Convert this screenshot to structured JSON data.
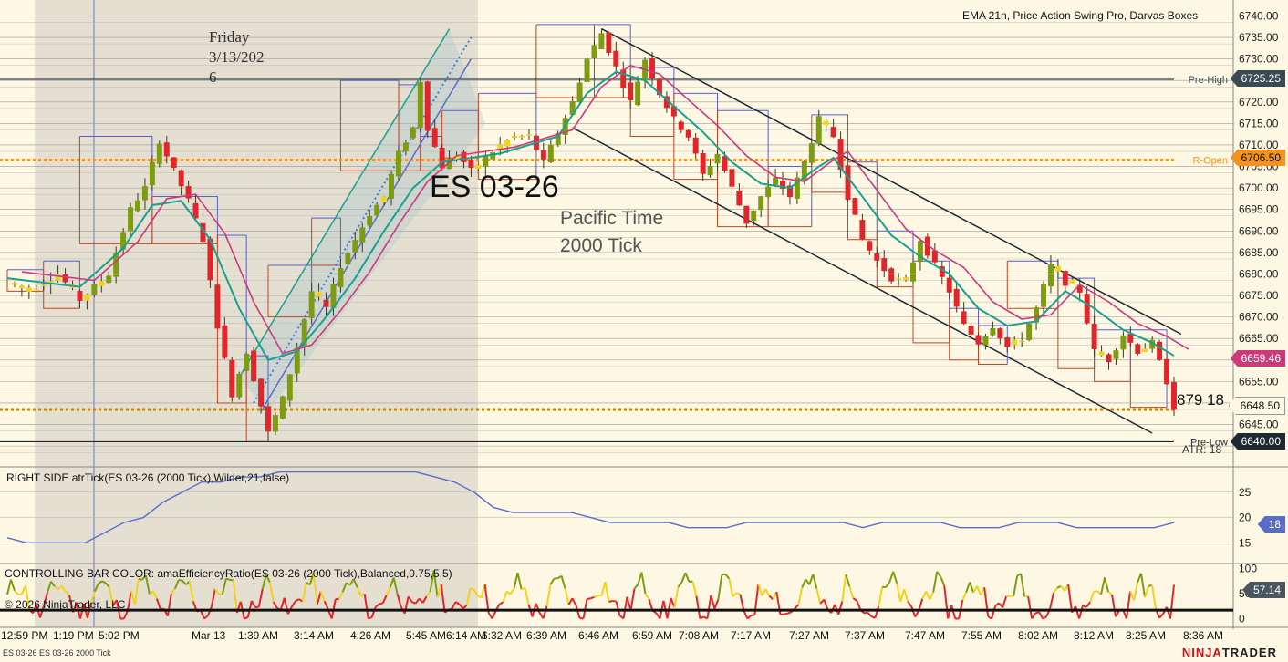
{
  "chart_data": {
    "type": "candlestick",
    "instrument": "ES 03-26",
    "subtitle_lines": [
      "Pacific Time",
      "2000 Tick"
    ],
    "session_label_lines": [
      "Friday",
      "3/13/202",
      "6"
    ],
    "indicators_title": "EMA 21n, Price Action Swing Pro, Darvas Boxes",
    "y_range": [
      6636,
      6742
    ],
    "y_ticks": [
      6640,
      6645,
      6650,
      6655,
      6660,
      6665,
      6670,
      6675,
      6680,
      6685,
      6690,
      6695,
      6700,
      6705,
      6710,
      6715,
      6720,
      6725,
      6730,
      6735,
      6740
    ],
    "y_tick_labels": [
      "6640.00",
      "6645.00",
      "6650.00",
      "6655.00",
      "6660.00",
      "6665.00",
      "6670.00",
      "6675.00",
      "6680.00",
      "6685.00",
      "6690.00",
      "6695.00",
      "6700.00",
      "6705.00",
      "6710.00",
      "6715.00",
      "6720.00",
      "6725.00",
      "6730.00",
      "6735.00",
      "6740.00"
    ],
    "x_tick_labels": [
      "12:59 PM",
      "1:19 PM",
      "5:02 PM",
      "Mar 13",
      "1:39 AM",
      "3:14 AM",
      "4:26 AM",
      "5:45 AM",
      "6:14 AM",
      "6:32 AM",
      "6:39 AM",
      "6:46 AM",
      "6:59 AM",
      "7:08 AM",
      "7:17 AM",
      "7:27 AM",
      "7:37 AM",
      "7:47 AM",
      "7:55 AM",
      "8:02 AM",
      "8:12 AM",
      "8:25 AM",
      "8:36 AM"
    ],
    "price_path": [
      [
        0,
        6678
      ],
      [
        3,
        6676
      ],
      [
        7,
        6680
      ],
      [
        10,
        6674
      ],
      [
        14,
        6680
      ],
      [
        17,
        6695
      ],
      [
        19,
        6700
      ],
      [
        21,
        6711
      ],
      [
        23,
        6704
      ],
      [
        25,
        6697
      ],
      [
        27,
        6688
      ],
      [
        29,
        6668
      ],
      [
        31,
        6652
      ],
      [
        33,
        6662
      ],
      [
        36,
        6643
      ],
      [
        38,
        6651
      ],
      [
        40,
        6663
      ],
      [
        42,
        6676
      ],
      [
        44,
        6672
      ],
      [
        46,
        6682
      ],
      [
        48,
        6688
      ],
      [
        50,
        6694
      ],
      [
        52,
        6698
      ],
      [
        54,
        6708
      ],
      [
        56,
        6714
      ],
      [
        57,
        6725
      ],
      [
        58,
        6714
      ],
      [
        60,
        6705
      ],
      [
        62,
        6708
      ],
      [
        64,
        6704
      ],
      [
        66,
        6707
      ],
      [
        68,
        6710
      ],
      [
        70,
        6712
      ],
      [
        72,
        6712
      ],
      [
        74,
        6706
      ],
      [
        76,
        6713
      ],
      [
        78,
        6720
      ],
      [
        80,
        6730
      ],
      [
        82,
        6736
      ],
      [
        84,
        6728
      ],
      [
        86,
        6720
      ],
      [
        88,
        6730
      ],
      [
        90,
        6722
      ],
      [
        92,
        6716
      ],
      [
        94,
        6712
      ],
      [
        96,
        6703
      ],
      [
        98,
        6708
      ],
      [
        100,
        6700
      ],
      [
        102,
        6692
      ],
      [
        104,
        6698
      ],
      [
        106,
        6702
      ],
      [
        108,
        6698
      ],
      [
        110,
        6706
      ],
      [
        112,
        6716
      ],
      [
        114,
        6712
      ],
      [
        116,
        6698
      ],
      [
        118,
        6688
      ],
      [
        120,
        6683
      ],
      [
        122,
        6679
      ],
      [
        124,
        6678
      ],
      [
        126,
        6688
      ],
      [
        128,
        6682
      ],
      [
        130,
        6676
      ],
      [
        132,
        6668
      ],
      [
        134,
        6664
      ],
      [
        136,
        6668
      ],
      [
        138,
        6663
      ],
      [
        140,
        6665
      ],
      [
        142,
        6672
      ],
      [
        144,
        6682
      ],
      [
        146,
        6678
      ],
      [
        148,
        6676
      ],
      [
        150,
        6662
      ],
      [
        152,
        6660
      ],
      [
        154,
        6666
      ],
      [
        156,
        6662
      ],
      [
        158,
        6664
      ],
      [
        160,
        6655
      ],
      [
        161,
        6649
      ]
    ],
    "ema_path": [
      [
        0,
        6679
      ],
      [
        10,
        6677
      ],
      [
        16,
        6686
      ],
      [
        20,
        6696
      ],
      [
        24,
        6697
      ],
      [
        28,
        6688
      ],
      [
        32,
        6672
      ],
      [
        36,
        6660
      ],
      [
        40,
        6662
      ],
      [
        44,
        6670
      ],
      [
        48,
        6679
      ],
      [
        52,
        6690
      ],
      [
        56,
        6700
      ],
      [
        60,
        6706
      ],
      [
        64,
        6707
      ],
      [
        68,
        6708
      ],
      [
        72,
        6710
      ],
      [
        76,
        6712
      ],
      [
        80,
        6722
      ],
      [
        84,
        6727
      ],
      [
        88,
        6725
      ],
      [
        92,
        6719
      ],
      [
        96,
        6713
      ],
      [
        100,
        6706
      ],
      [
        104,
        6701
      ],
      [
        108,
        6700
      ],
      [
        112,
        6705
      ],
      [
        114,
        6707
      ],
      [
        118,
        6698
      ],
      [
        122,
        6689
      ],
      [
        126,
        6684
      ],
      [
        130,
        6680
      ],
      [
        134,
        6672
      ],
      [
        138,
        6668
      ],
      [
        142,
        6669
      ],
      [
        146,
        6676
      ],
      [
        150,
        6672
      ],
      [
        154,
        6667
      ],
      [
        158,
        6664
      ],
      [
        161,
        6661
      ]
    ],
    "darvas_boxes": [
      [
        0,
        5,
        6681,
        6676
      ],
      [
        5,
        10,
        6683,
        6672
      ],
      [
        10,
        20,
        6712,
        6687
      ],
      [
        20,
        29,
        6698,
        6687
      ],
      [
        29,
        33,
        6689,
        6650
      ],
      [
        33,
        36,
        6661,
        6641
      ],
      [
        36,
        42,
        6682,
        6670
      ],
      [
        42,
        46,
        6693,
        6682
      ],
      [
        46,
        54,
        6725,
        6704
      ],
      [
        54,
        57,
        6724,
        6704
      ],
      [
        57,
        60,
        6712,
        6704
      ],
      [
        60,
        65,
        6718,
        6707
      ],
      [
        65,
        73,
        6722,
        6702
      ],
      [
        73,
        81,
        6738,
        6721
      ],
      [
        81,
        86,
        6738,
        6721
      ],
      [
        86,
        92,
        6728,
        6712
      ],
      [
        92,
        98,
        6722,
        6702
      ],
      [
        98,
        105,
        6718,
        6691
      ],
      [
        105,
        111,
        6705,
        6691
      ],
      [
        111,
        116,
        6717,
        6699
      ],
      [
        116,
        120,
        6706,
        6688
      ],
      [
        120,
        125,
        6690,
        6677
      ],
      [
        125,
        130,
        6683,
        6664
      ],
      [
        130,
        134,
        6672,
        6660
      ],
      [
        134,
        138,
        6668,
        6659
      ],
      [
        138,
        145,
        6683,
        6672
      ],
      [
        145,
        150,
        6679,
        6658
      ],
      [
        150,
        155,
        6667,
        6655
      ],
      [
        155,
        160,
        6667,
        6649
      ]
    ],
    "channel_lines": [
      [
        [
          32,
          6656
        ],
        [
          61,
          6737
        ],
        "#1aa08e"
      ],
      [
        [
          35,
          6648
        ],
        [
          64,
          6730
        ],
        "#5a6cc9"
      ],
      [
        [
          34,
          6650
        ],
        [
          64,
          6735
        ],
        "#3a7de0"
      ],
      [
        [
          82,
          6737
        ],
        [
          162,
          6666
        ],
        "#1e2a33"
      ],
      [
        [
          78,
          6714
        ],
        [
          158,
          6643
        ],
        "#1e2a33"
      ]
    ],
    "hlines": [
      {
        "value": 6725.25,
        "color": "#3a4a55",
        "label": "Pre-High",
        "tag": "6725.25",
        "tagColor": "#3a4a55"
      },
      {
        "value": 6706.5,
        "color": "#f5921e",
        "dashed": true,
        "label": "R-Open",
        "tag": "6706.50",
        "tagColor": "#f5921e"
      },
      {
        "value": 6648.5,
        "color": "#b8860b",
        "dashed": true,
        "tag": "6648.50",
        "tagColor": "#1e2a33",
        "textColor": "#1e2a33"
      },
      {
        "value": 6641,
        "color": "#1e2a33",
        "label": "Pre-Low",
        "tag": "6640.00",
        "tagColor": "#1e2a33"
      }
    ],
    "ema_tag": {
      "value": 6659.46,
      "text": "6659.46",
      "color": "#cc3a7c"
    },
    "last_price_note": "879  18",
    "atr_label": "ATR: 18",
    "atr_panel": {
      "title": "RIGHT SIDE atrTick(ES 03-26 (2000 Tick),Wilder,21,false)",
      "y_ticks": [
        15,
        20,
        25
      ],
      "last_value": "18",
      "values": [
        16,
        15,
        15,
        15,
        15,
        17,
        19,
        20,
        23,
        25,
        27,
        27,
        28,
        28,
        29,
        29,
        29,
        29,
        29,
        29,
        29,
        29,
        28,
        27,
        25,
        22,
        21,
        21,
        21,
        21,
        20,
        19,
        19,
        19,
        19,
        18,
        18,
        18,
        19,
        19,
        19,
        19,
        19,
        19,
        18,
        19,
        19,
        19,
        19,
        18,
        18,
        18,
        19,
        19,
        19,
        18,
        18,
        18,
        18,
        18,
        19
      ]
    },
    "er_panel": {
      "title": "CONTROLLING BAR COLOR: amaEfficiencyRatio(ES 03-26 (2000 Tick),Balanced,0.75,5,5)",
      "y_ticks": [
        0,
        50,
        100
      ],
      "last_value": "57.14"
    },
    "copyright": "© 2026 NinjaTrader, LLC",
    "footer_left": "ES 03-26  ES 03-26 2000 Tick",
    "brand_left": "NINJA",
    "brand_right": "TRADER"
  }
}
